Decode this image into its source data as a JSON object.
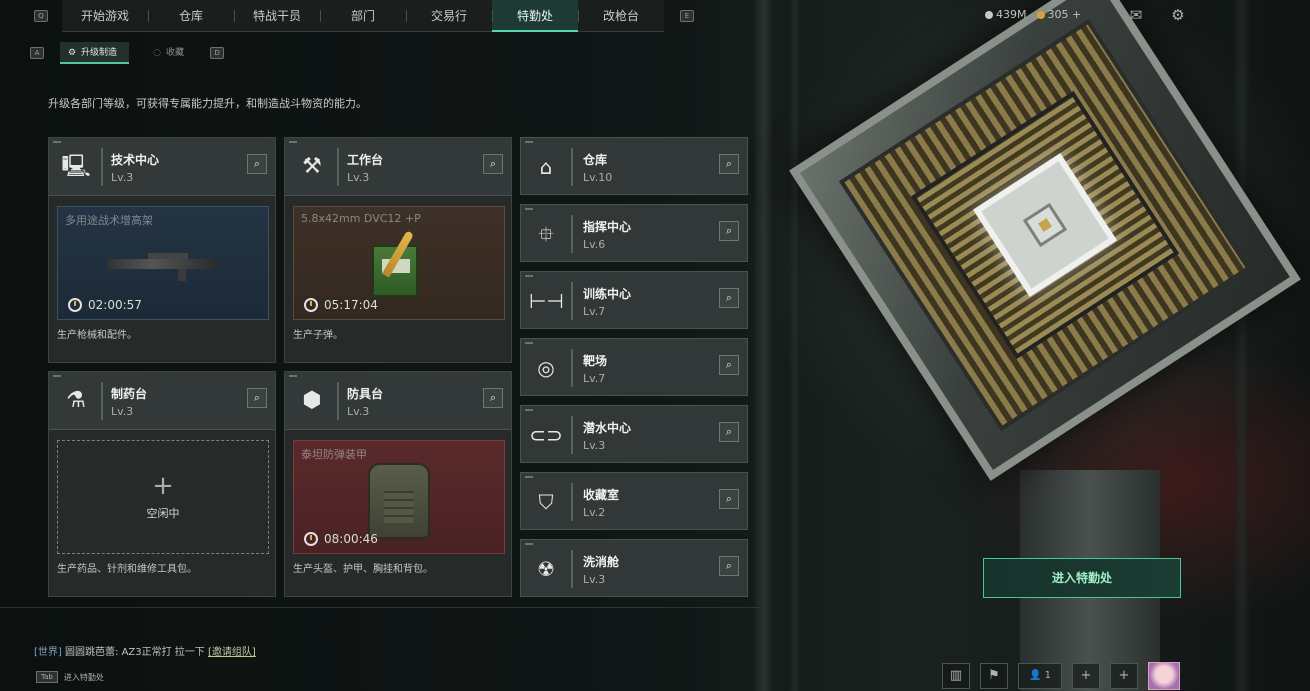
{
  "nav": {
    "key_left": "Q",
    "key_right": "E",
    "tabs": [
      {
        "label": "开始游戏"
      },
      {
        "label": "仓库"
      },
      {
        "label": "特战干员"
      },
      {
        "label": "部门"
      },
      {
        "label": "交易行"
      },
      {
        "label": "特勤处"
      },
      {
        "label": "改枪台"
      }
    ],
    "active_tab": "特勤处"
  },
  "currency": {
    "coins": "439M",
    "premium": "305 +"
  },
  "subnav": {
    "key_left": "A",
    "key_right": "D",
    "items": [
      {
        "label": "升级制造"
      },
      {
        "label": "收藏"
      }
    ]
  },
  "description": "升级各部门等级，可获得专属能力提升，和制造战斗物资的能力。",
  "production": [
    {
      "name": "技术中心",
      "level": "Lv.3",
      "item": "多用途战术增高架",
      "timer": "02:00:57",
      "footer": "生产枪械和配件。"
    },
    {
      "name": "工作台",
      "level": "Lv.3",
      "item": "5.8x42mm DVC12 +P",
      "timer": "05:17:04",
      "footer": "生产子弹。"
    },
    {
      "name": "制药台",
      "level": "Lv.3",
      "idle": "空闲中",
      "footer": "生产药品、针剂和维修工具包。"
    },
    {
      "name": "防具台",
      "level": "Lv.3",
      "item": "泰坦防弹装甲",
      "timer": "08:00:46",
      "footer": "生产头盔、护甲、胸挂和背包。"
    }
  ],
  "facilities": [
    {
      "name": "仓库",
      "level": "Lv.10"
    },
    {
      "name": "指挥中心",
      "level": "Lv.6"
    },
    {
      "name": "训练中心",
      "level": "Lv.7"
    },
    {
      "name": "靶场",
      "level": "Lv.7"
    },
    {
      "name": "潜水中心",
      "level": "Lv.3"
    },
    {
      "name": "收藏室",
      "level": "Lv.2"
    },
    {
      "name": "洗消舱",
      "level": "Lv.3"
    }
  ],
  "enter_button": "进入特勤处",
  "chat": {
    "channel": "[世界]",
    "user": "圆圆跳芭蕾:",
    "message": "AZ3正常打 拉一下",
    "invite": "[邀请组队]"
  },
  "hint": {
    "key": "Tab",
    "label": "进入特勤处"
  },
  "bottom": {
    "players": "1"
  },
  "colors": {
    "accent": "#58d6ae",
    "tech_bg": "#243444",
    "workbench_bg": "#3e3128",
    "armor_bg": "#5a2a2c"
  }
}
